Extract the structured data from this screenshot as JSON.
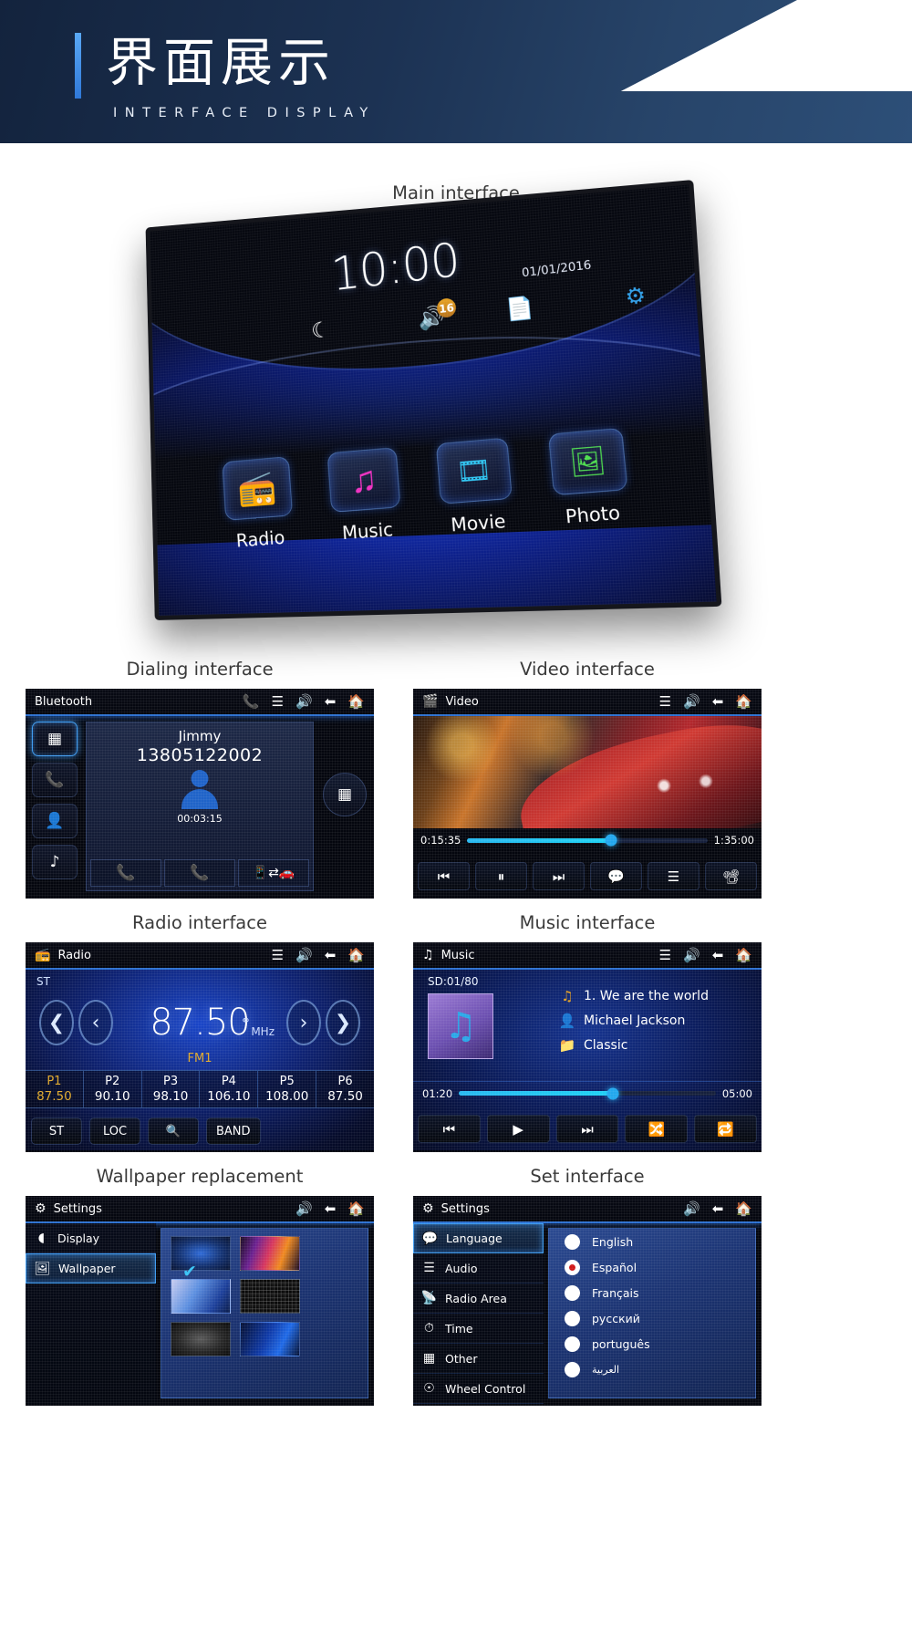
{
  "banner": {
    "title_cn": "界面展示",
    "title_en": "INTERFACE DISPLAY"
  },
  "captions": {
    "main": "Main interface",
    "dialing": "Dialing interface",
    "video": "Video interface",
    "radio": "Radio interface",
    "music": "Music interface",
    "wallpaper": "Wallpaper replacement",
    "settings": "Set interface"
  },
  "main_interface": {
    "time": "10:00",
    "date": "01/01/2016",
    "status_icons": [
      "moon-star-icon",
      "volume-icon",
      "gallery-icon",
      "gear-icon"
    ],
    "volume_badge": "16",
    "apps": [
      {
        "label": "Radio",
        "icon": "radio-icon",
        "glyph": "📻"
      },
      {
        "label": "Music",
        "icon": "music-note-icon",
        "glyph": "♫"
      },
      {
        "label": "Movie",
        "icon": "film-icon",
        "glyph": "⬛"
      },
      {
        "label": "Photo",
        "icon": "photo-icon",
        "glyph": "🖼"
      }
    ]
  },
  "dialing": {
    "title": "Bluetooth",
    "head_icons": [
      "phone-icon",
      "equalizer-icon",
      "volume-icon",
      "back-icon",
      "home-icon"
    ],
    "left_buttons": [
      "keypad-icon",
      "call-log-icon",
      "contacts-icon",
      "music-icon"
    ],
    "contact_name": "Jimmy",
    "contact_number": "13805122002",
    "call_timer": "00:03:15",
    "actions": [
      "answer-call",
      "end-call",
      "transfer-call"
    ],
    "right_button": "keypad-icon"
  },
  "video": {
    "title": "Video",
    "head_icons": [
      "equalizer-icon",
      "volume-icon",
      "back-icon",
      "home-icon"
    ],
    "elapsed": "0:15:35",
    "duration": "1:35:00",
    "progress_percent": 60,
    "controls": [
      "previous-icon",
      "pause-icon",
      "next-icon",
      "subtitle-icon",
      "list-icon",
      "screen-icon"
    ]
  },
  "radio": {
    "title": "Radio",
    "head_icons": [
      "equalizer-icon",
      "volume-icon",
      "back-icon",
      "home-icon"
    ],
    "stereo_label": "ST",
    "frequency": "87.50",
    "unit": "MHz",
    "band": "FM1",
    "presets": [
      {
        "name": "P1",
        "freq": "87.50",
        "active": true
      },
      {
        "name": "P2",
        "freq": "90.10",
        "active": false
      },
      {
        "name": "P3",
        "freq": "98.10",
        "active": false
      },
      {
        "name": "P4",
        "freq": "106.10",
        "active": false
      },
      {
        "name": "P5",
        "freq": "108.00",
        "active": false
      },
      {
        "name": "P6",
        "freq": "87.50",
        "active": false
      }
    ],
    "buttons": [
      "ST",
      "LOC",
      "search-icon",
      "BAND"
    ]
  },
  "music": {
    "title": "Music",
    "head_icons": [
      "equalizer-icon",
      "volume-icon",
      "back-icon",
      "home-icon"
    ],
    "source": "SD:01/80",
    "track": "1.  We are the world",
    "artist": "Michael Jackson",
    "genre": "Classic",
    "elapsed": "01:20",
    "duration": "05:00",
    "progress_percent": 60,
    "controls": [
      "previous-icon",
      "play-icon",
      "next-icon",
      "shuffle-icon",
      "repeat-icon"
    ]
  },
  "wallpaper": {
    "title": "Settings",
    "head_icons": [
      "volume-icon",
      "back-icon",
      "home-icon"
    ],
    "nav": [
      {
        "label": "Display",
        "icon": "contrast-icon",
        "selected": false
      },
      {
        "label": "Wallpaper",
        "icon": "image-icon",
        "selected": true
      }
    ],
    "thumbs": [
      {
        "cls": "wp-1",
        "checked": true
      },
      {
        "cls": "wp-2",
        "checked": false
      },
      {
        "cls": "wp-3",
        "checked": false
      },
      {
        "cls": "wp-4",
        "checked": false
      },
      {
        "cls": "wp-5",
        "checked": false
      },
      {
        "cls": "wp-6",
        "checked": false
      }
    ]
  },
  "settings": {
    "title": "Settings",
    "head_icons": [
      "volume-icon",
      "back-icon",
      "home-icon"
    ],
    "nav": [
      {
        "label": "Language",
        "icon": "speech-icon",
        "selected": true
      },
      {
        "label": "Audio",
        "icon": "equalizer-icon",
        "selected": false
      },
      {
        "label": "Radio Area",
        "icon": "antenna-icon",
        "selected": false
      },
      {
        "label": "Time",
        "icon": "clock-icon",
        "selected": false
      },
      {
        "label": "Other",
        "icon": "grid-icon",
        "selected": false
      },
      {
        "label": "Wheel Control",
        "icon": "steering-wheel-icon",
        "selected": false
      }
    ],
    "languages": [
      {
        "label": "English",
        "selected": false
      },
      {
        "label": "Español",
        "selected": true
      },
      {
        "label": "Français",
        "selected": false
      },
      {
        "label": "русский",
        "selected": false
      },
      {
        "label": "português",
        "selected": false
      },
      {
        "label": "العربية",
        "selected": false
      }
    ]
  },
  "colors": {
    "banner_dark": "#13233d",
    "accent_blue": "#3d9bf0",
    "amber": "#e0a92c",
    "call_green": "#2ecc40",
    "call_red": "#d0211f"
  }
}
